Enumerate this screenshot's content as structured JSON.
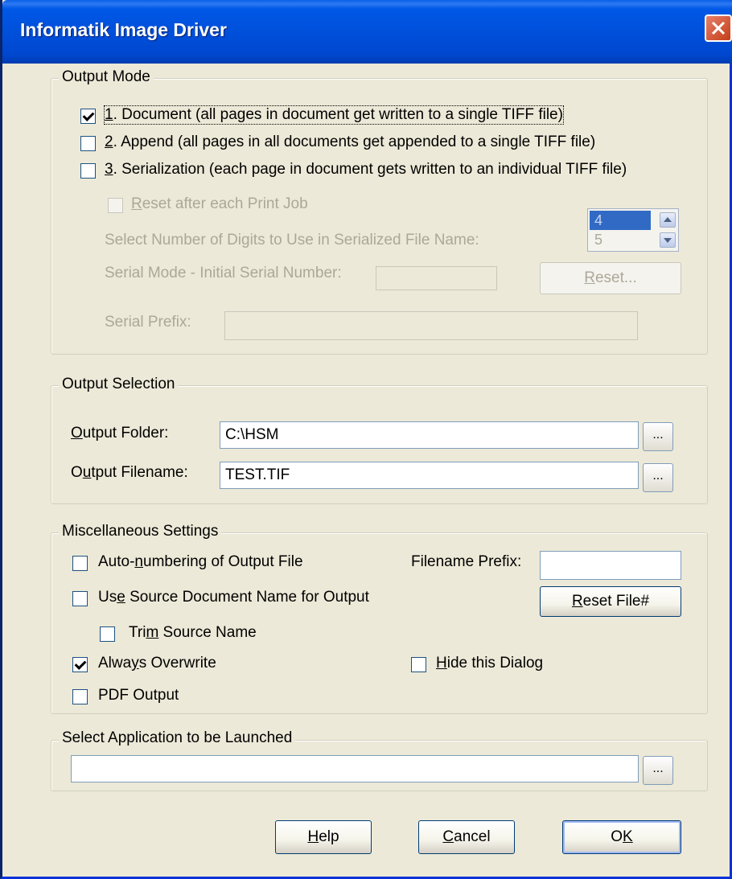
{
  "window": {
    "title": "Informatik Image Driver"
  },
  "output_mode": {
    "label": "Output Mode",
    "options": [
      {
        "key": "1",
        "label": ". Document (all pages in document get written to a single TIFF file)",
        "checked": true
      },
      {
        "key": "2",
        "label": ". Append (all pages in all documents get appended to a single TIFF file)",
        "checked": false
      },
      {
        "key": "3",
        "label": ". Serialization (each page in document gets written to an individual TIFF file)",
        "checked": false
      }
    ],
    "reset_after_job": {
      "key": "R",
      "label": "eset after each Print Job",
      "checked": false
    },
    "digits_label": "Select Number of Digits to Use in Serialized File Name:",
    "digits_options": [
      "4",
      "5"
    ],
    "digits_selected": "4",
    "initial_serial_label": "Serial Mode - Initial Serial Number:",
    "initial_serial_value": "",
    "reset_button": {
      "key": "R",
      "label": "eset..."
    },
    "serial_prefix_label": "Serial Prefix:",
    "serial_prefix_value": ""
  },
  "output_selection": {
    "label": "Output Selection",
    "folder_label_key": "O",
    "folder_label_rest": "utput Folder:",
    "folder_value": "C:\\HSM",
    "filename_label_pre": "O",
    "filename_label_key": "u",
    "filename_label_rest": "tput Filename:",
    "filename_value": "TEST.TIF",
    "browse_label": "..."
  },
  "misc": {
    "label": "Miscellaneous Settings",
    "auto_numbering": {
      "pre": "Auto-",
      "key": "n",
      "rest": "umbering of Output File",
      "checked": false
    },
    "use_source": {
      "pre": "Us",
      "key": "e",
      "rest": " Source Document Name for Output",
      "checked": false
    },
    "trim_source": {
      "pre": "Tri",
      "key": "m",
      "rest": " Source Name",
      "checked": false
    },
    "always_overwrite": {
      "pre": "Alwa",
      "key": "y",
      "rest": "s Overwrite",
      "checked": true
    },
    "pdf_output": {
      "label": "PDF Output",
      "checked": false
    },
    "filename_prefix_label": "Filename Prefix:",
    "filename_prefix_value": "",
    "reset_file_button": {
      "key": "R",
      "rest": "eset File#"
    },
    "hide_dialog": {
      "key": "H",
      "rest": "ide this Dialog",
      "checked": false
    }
  },
  "launch_app": {
    "label": "Select Application to be Launched",
    "value": "",
    "browse_label": "..."
  },
  "buttons": {
    "help": {
      "key": "H",
      "rest": "elp"
    },
    "cancel": {
      "key": "C",
      "rest": "ancel"
    },
    "ok": {
      "pre": "O",
      "key": "K"
    }
  },
  "colors": {
    "titlebar": "#0054E3",
    "dialog_bg": "#ECE9D8",
    "selection": "#316AC5"
  }
}
